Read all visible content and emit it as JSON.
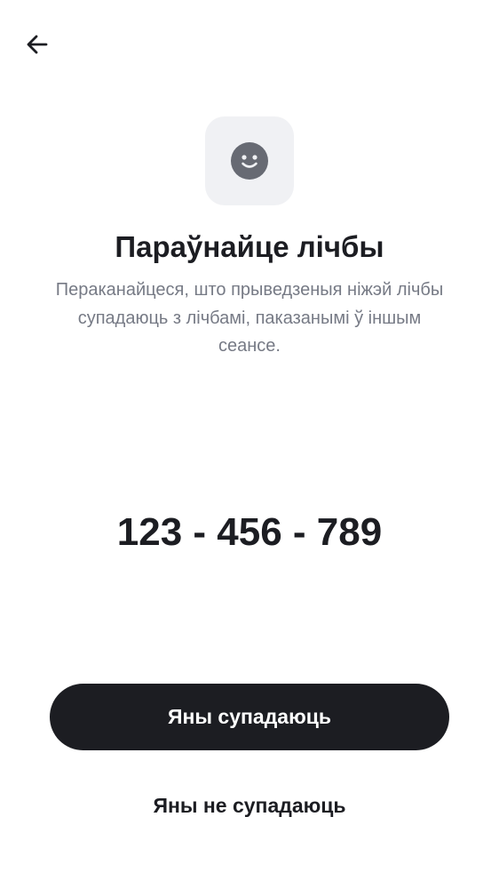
{
  "header": {
    "back_icon": "arrow-left-icon"
  },
  "hero": {
    "icon": "smiley-face-icon",
    "icon_color": "#676a73",
    "tile_color": "#f0f1f4"
  },
  "content": {
    "title": "Параўнайце лічбы",
    "subtitle": "Пераканайцеся, што прыведзеныя ніжэй лічбы супадаюць з лічбамі, паказанымі ў іншым сеансе.",
    "code": "123 - 456 - 789"
  },
  "actions": {
    "confirm_label": "Яны супадаюць",
    "reject_label": "Яны не супадаюць"
  },
  "colors": {
    "text": "#1c1d22",
    "secondary_text": "#767a85",
    "primary_button": "#1c1d22",
    "background": "#ffffff"
  }
}
